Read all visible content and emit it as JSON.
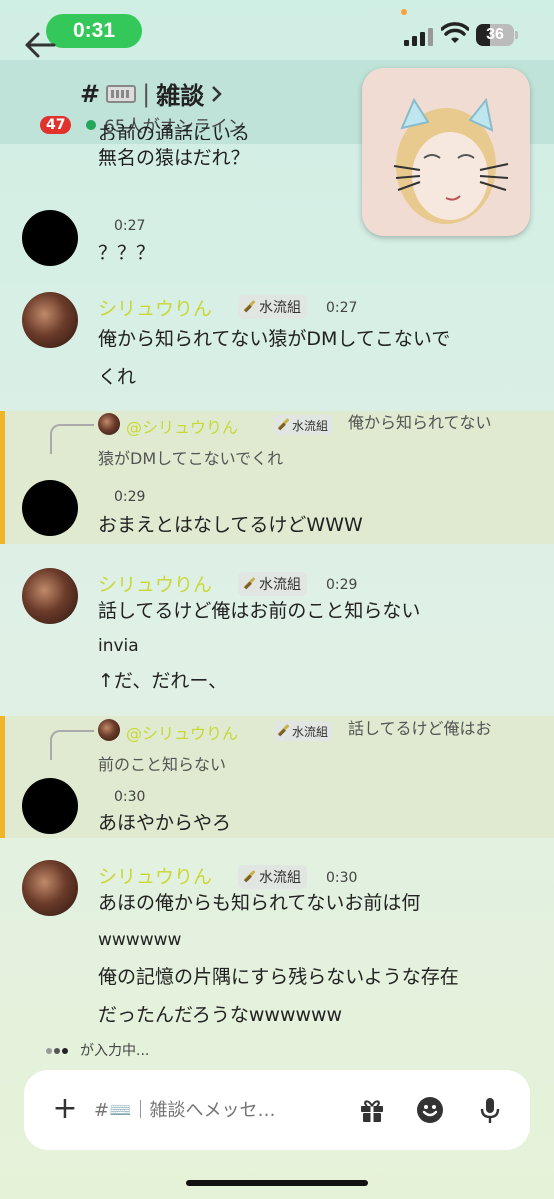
{
  "status": {
    "time": "0:31",
    "battery": "36"
  },
  "header": {
    "unread_badge": "47",
    "channel_prefix": "#",
    "channel_name": "雑談",
    "separator": "|",
    "online_text": "65人がオンライン"
  },
  "messages": [
    {
      "type": "continuation",
      "lines": [
        "お前の通話にいる",
        "無名の猿はだれ？"
      ]
    },
    {
      "type": "message",
      "author": "",
      "time": "0:27",
      "lines": [
        "？？？"
      ]
    },
    {
      "type": "message",
      "author": "シリュウりん",
      "role": "水流組",
      "time": "0:27",
      "lines": [
        "俺から知られてない猿がDMしてこないで",
        "くれ"
      ]
    },
    {
      "type": "reply",
      "reply_to": "@シリュウりん",
      "reply_role": "水流組",
      "reply_preview": [
        "俺から知られてない",
        "猿がDMしてこないでくれ"
      ],
      "time": "0:29",
      "lines": [
        "おまえとはなしてるけどWWW"
      ]
    },
    {
      "type": "message",
      "author": "シリュウりん",
      "role": "水流組",
      "time": "0:29",
      "lines": [
        "話してるけど俺はお前のこと知らない",
        "invia",
        "↑だ、だれー、"
      ]
    },
    {
      "type": "reply",
      "reply_to": "@シリュウりん",
      "reply_role": "水流組",
      "reply_preview": [
        "話してるけど俺はお",
        "前のこと知らない"
      ],
      "time": "0:30",
      "lines": [
        "あほやからやろ"
      ]
    },
    {
      "type": "message",
      "author": "シリュウりん",
      "role": "水流組",
      "time": "0:30",
      "lines": [
        "あほの俺からも知られてないお前は何",
        "wwwwww",
        "俺の記憶の片隅にすら残らないような存在",
        "だったんだろうなwwwwww"
      ]
    }
  ],
  "typing": "が入力中...",
  "composer": {
    "placeholder": "#⌨️｜雑談へメッセ…"
  },
  "colors": {
    "accent_name": "#c9d835",
    "reply_bar": "#f0b429",
    "online": "#23a55a",
    "badge": "#e1332e",
    "time_pill": "#34c759"
  },
  "icons": [
    "back-arrow-icon",
    "chevron-right-icon",
    "plus-icon",
    "gift-icon",
    "emoji-icon",
    "microphone-icon",
    "wifi-icon",
    "signal-icon",
    "battery-icon",
    "keyboard-icon",
    "sword-icon"
  ]
}
